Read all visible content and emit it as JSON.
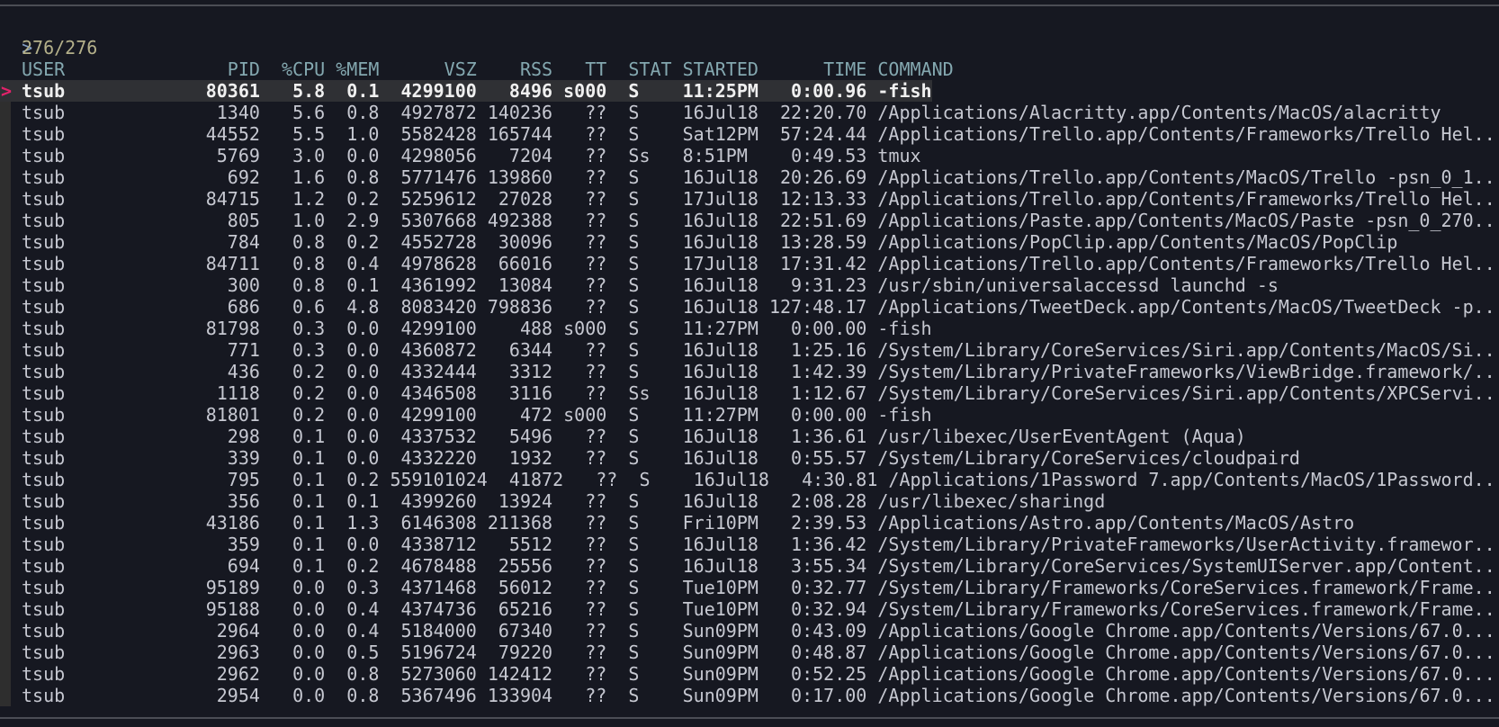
{
  "prompt": {
    "symbol": ">",
    "query": ""
  },
  "count": "276/276",
  "pointer": ">",
  "selected_index": 0,
  "colors": {
    "background": "#161821",
    "pointer": "#e2226a",
    "header": "#84a8b0",
    "count": "#b4b08a",
    "prompt": "#84a0c6",
    "text": "#c6c8d1"
  },
  "header": {
    "user": "USER",
    "pid": "PID",
    "cpu": "%CPU",
    "mem": "%MEM",
    "vsz": "VSZ",
    "rss": "RSS",
    "tt": "TT",
    "stat": "STAT",
    "started": "STARTED",
    "time": "TIME",
    "command": "COMMAND"
  },
  "rows": [
    {
      "user": "tsub",
      "pid": "80361",
      "cpu": "5.8",
      "mem": "0.1",
      "vsz": "4299100",
      "rss": "8496",
      "tt": "s000",
      "stat": "S",
      "started": "11:25PM",
      "time": "0:00.96",
      "command": "-fish"
    },
    {
      "user": "tsub",
      "pid": "1340",
      "cpu": "5.6",
      "mem": "0.8",
      "vsz": "4927872",
      "rss": "140236",
      "tt": "??",
      "stat": "S",
      "started": "16Jul18",
      "time": "22:20.70",
      "command": "/Applications/Alacritty.app/Contents/MacOS/alacritty"
    },
    {
      "user": "tsub",
      "pid": "44552",
      "cpu": "5.5",
      "mem": "1.0",
      "vsz": "5582428",
      "rss": "165744",
      "tt": "??",
      "stat": "S",
      "started": "Sat12PM",
      "time": "57:24.44",
      "command": "/Applications/Trello.app/Contents/Frameworks/Trello Hel.."
    },
    {
      "user": "tsub",
      "pid": "5769",
      "cpu": "3.0",
      "mem": "0.0",
      "vsz": "4298056",
      "rss": "7204",
      "tt": "??",
      "stat": "Ss",
      "started": "8:51PM",
      "time": "0:49.53",
      "command": "tmux"
    },
    {
      "user": "tsub",
      "pid": "692",
      "cpu": "1.6",
      "mem": "0.8",
      "vsz": "5771476",
      "rss": "139860",
      "tt": "??",
      "stat": "S",
      "started": "16Jul18",
      "time": "20:26.69",
      "command": "/Applications/Trello.app/Contents/MacOS/Trello -psn_0_1.."
    },
    {
      "user": "tsub",
      "pid": "84715",
      "cpu": "1.2",
      "mem": "0.2",
      "vsz": "5259612",
      "rss": "27028",
      "tt": "??",
      "stat": "S",
      "started": "17Jul18",
      "time": "12:13.33",
      "command": "/Applications/Trello.app/Contents/Frameworks/Trello Hel.."
    },
    {
      "user": "tsub",
      "pid": "805",
      "cpu": "1.0",
      "mem": "2.9",
      "vsz": "5307668",
      "rss": "492388",
      "tt": "??",
      "stat": "S",
      "started": "16Jul18",
      "time": "22:51.69",
      "command": "/Applications/Paste.app/Contents/MacOS/Paste -psn_0_270.."
    },
    {
      "user": "tsub",
      "pid": "784",
      "cpu": "0.8",
      "mem": "0.2",
      "vsz": "4552728",
      "rss": "30096",
      "tt": "??",
      "stat": "S",
      "started": "16Jul18",
      "time": "13:28.59",
      "command": "/Applications/PopClip.app/Contents/MacOS/PopClip"
    },
    {
      "user": "tsub",
      "pid": "84711",
      "cpu": "0.8",
      "mem": "0.4",
      "vsz": "4978628",
      "rss": "66016",
      "tt": "??",
      "stat": "S",
      "started": "17Jul18",
      "time": "17:31.42",
      "command": "/Applications/Trello.app/Contents/Frameworks/Trello Hel.."
    },
    {
      "user": "tsub",
      "pid": "300",
      "cpu": "0.8",
      "mem": "0.1",
      "vsz": "4361992",
      "rss": "13084",
      "tt": "??",
      "stat": "S",
      "started": "16Jul18",
      "time": "9:31.23",
      "command": "/usr/sbin/universalaccessd launchd -s"
    },
    {
      "user": "tsub",
      "pid": "686",
      "cpu": "0.6",
      "mem": "4.8",
      "vsz": "8083420",
      "rss": "798836",
      "tt": "??",
      "stat": "S",
      "started": "16Jul18",
      "time": "127:48.17",
      "command": "/Applications/TweetDeck.app/Contents/MacOS/TweetDeck -p.."
    },
    {
      "user": "tsub",
      "pid": "81798",
      "cpu": "0.3",
      "mem": "0.0",
      "vsz": "4299100",
      "rss": "488",
      "tt": "s000",
      "stat": "S",
      "started": "11:27PM",
      "time": "0:00.00",
      "command": "-fish"
    },
    {
      "user": "tsub",
      "pid": "771",
      "cpu": "0.3",
      "mem": "0.0",
      "vsz": "4360872",
      "rss": "6344",
      "tt": "??",
      "stat": "S",
      "started": "16Jul18",
      "time": "1:25.16",
      "command": "/System/Library/CoreServices/Siri.app/Contents/MacOS/Si.."
    },
    {
      "user": "tsub",
      "pid": "436",
      "cpu": "0.2",
      "mem": "0.0",
      "vsz": "4332444",
      "rss": "3312",
      "tt": "??",
      "stat": "S",
      "started": "16Jul18",
      "time": "1:42.39",
      "command": "/System/Library/PrivateFrameworks/ViewBridge.framework/.."
    },
    {
      "user": "tsub",
      "pid": "1118",
      "cpu": "0.2",
      "mem": "0.0",
      "vsz": "4346508",
      "rss": "3116",
      "tt": "??",
      "stat": "Ss",
      "started": "16Jul18",
      "time": "1:12.67",
      "command": "/System/Library/CoreServices/Siri.app/Contents/XPCServi.."
    },
    {
      "user": "tsub",
      "pid": "81801",
      "cpu": "0.2",
      "mem": "0.0",
      "vsz": "4299100",
      "rss": "472",
      "tt": "s000",
      "stat": "S",
      "started": "11:27PM",
      "time": "0:00.00",
      "command": "-fish"
    },
    {
      "user": "tsub",
      "pid": "298",
      "cpu": "0.1",
      "mem": "0.0",
      "vsz": "4337532",
      "rss": "5496",
      "tt": "??",
      "stat": "S",
      "started": "16Jul18",
      "time": "1:36.61",
      "command": "/usr/libexec/UserEventAgent (Aqua)"
    },
    {
      "user": "tsub",
      "pid": "339",
      "cpu": "0.1",
      "mem": "0.0",
      "vsz": "4332220",
      "rss": "1932",
      "tt": "??",
      "stat": "S",
      "started": "16Jul18",
      "time": "0:55.57",
      "command": "/System/Library/CoreServices/cloudpaird"
    },
    {
      "user": "tsub",
      "pid": "795",
      "cpu": "0.1",
      "mem": "0.2",
      "vsz": "559101024",
      "rss": "41872",
      "tt": "??",
      "stat": "S",
      "started": "16Jul18",
      "time": "4:30.81",
      "command": "/Applications/1Password 7.app/Contents/MacOS/1Password.."
    },
    {
      "user": "tsub",
      "pid": "356",
      "cpu": "0.1",
      "mem": "0.1",
      "vsz": "4399260",
      "rss": "13924",
      "tt": "??",
      "stat": "S",
      "started": "16Jul18",
      "time": "2:08.28",
      "command": "/usr/libexec/sharingd"
    },
    {
      "user": "tsub",
      "pid": "43186",
      "cpu": "0.1",
      "mem": "1.3",
      "vsz": "6146308",
      "rss": "211368",
      "tt": "??",
      "stat": "S",
      "started": "Fri10PM",
      "time": "2:39.53",
      "command": "/Applications/Astro.app/Contents/MacOS/Astro"
    },
    {
      "user": "tsub",
      "pid": "359",
      "cpu": "0.1",
      "mem": "0.0",
      "vsz": "4338712",
      "rss": "5512",
      "tt": "??",
      "stat": "S",
      "started": "16Jul18",
      "time": "1:36.42",
      "command": "/System/Library/PrivateFrameworks/UserActivity.framewor.."
    },
    {
      "user": "tsub",
      "pid": "694",
      "cpu": "0.1",
      "mem": "0.2",
      "vsz": "4678488",
      "rss": "25556",
      "tt": "??",
      "stat": "S",
      "started": "16Jul18",
      "time": "3:55.34",
      "command": "/System/Library/CoreServices/SystemUIServer.app/Content.."
    },
    {
      "user": "tsub",
      "pid": "95189",
      "cpu": "0.0",
      "mem": "0.3",
      "vsz": "4371468",
      "rss": "56012",
      "tt": "??",
      "stat": "S",
      "started": "Tue10PM",
      "time": "0:32.77",
      "command": "/System/Library/Frameworks/CoreServices.framework/Frame.."
    },
    {
      "user": "tsub",
      "pid": "95188",
      "cpu": "0.0",
      "mem": "0.4",
      "vsz": "4374736",
      "rss": "65216",
      "tt": "??",
      "stat": "S",
      "started": "Tue10PM",
      "time": "0:32.94",
      "command": "/System/Library/Frameworks/CoreServices.framework/Frame.."
    },
    {
      "user": "tsub",
      "pid": "2964",
      "cpu": "0.0",
      "mem": "0.4",
      "vsz": "5184000",
      "rss": "67340",
      "tt": "??",
      "stat": "S",
      "started": "Sun09PM",
      "time": "0:43.09",
      "command": "/Applications/Google Chrome.app/Contents/Versions/67.0..."
    },
    {
      "user": "tsub",
      "pid": "2963",
      "cpu": "0.0",
      "mem": "0.5",
      "vsz": "5196724",
      "rss": "79220",
      "tt": "??",
      "stat": "S",
      "started": "Sun09PM",
      "time": "0:48.87",
      "command": "/Applications/Google Chrome.app/Contents/Versions/67.0..."
    },
    {
      "user": "tsub",
      "pid": "2962",
      "cpu": "0.0",
      "mem": "0.8",
      "vsz": "5273060",
      "rss": "142412",
      "tt": "??",
      "stat": "S",
      "started": "Sun09PM",
      "time": "0:52.25",
      "command": "/Applications/Google Chrome.app/Contents/Versions/67.0..."
    },
    {
      "user": "tsub",
      "pid": "2954",
      "cpu": "0.0",
      "mem": "0.8",
      "vsz": "5367496",
      "rss": "133904",
      "tt": "??",
      "stat": "S",
      "started": "Sun09PM",
      "time": "0:17.00",
      "command": "/Applications/Google Chrome.app/Contents/Versions/67.0..."
    }
  ]
}
